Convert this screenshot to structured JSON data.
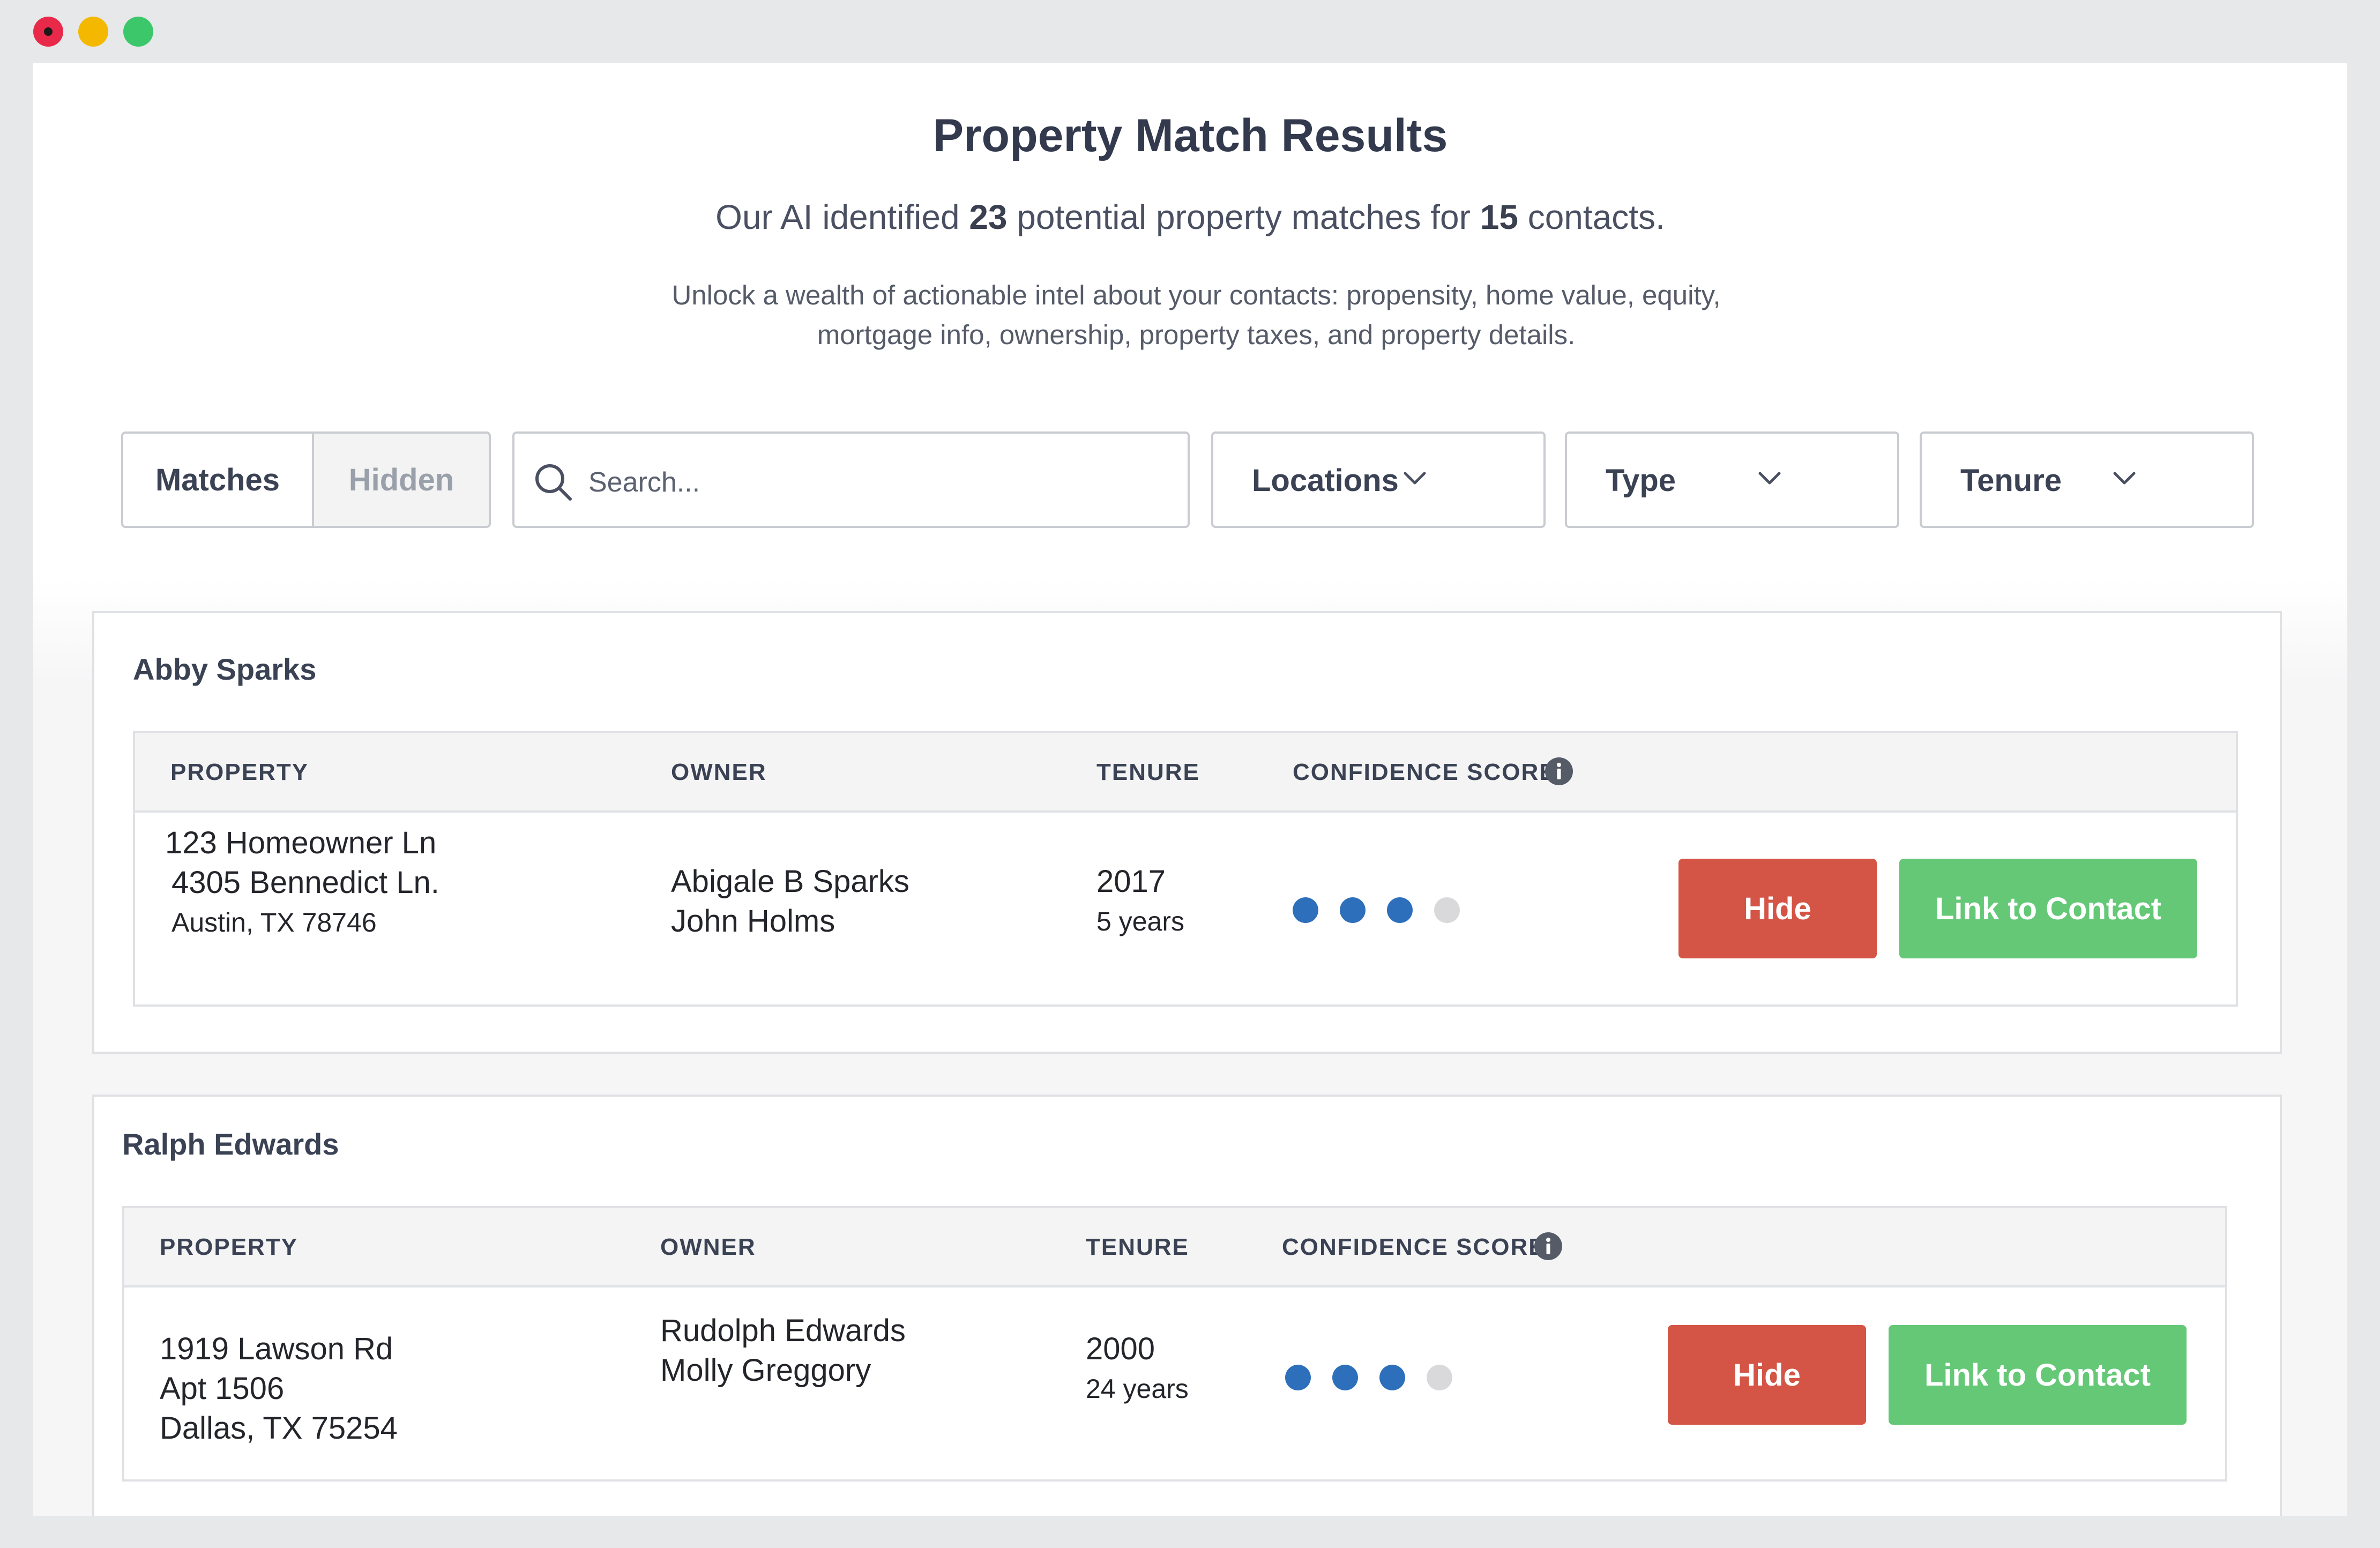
{
  "header": {
    "title": "Property Match Results",
    "subtitle_prefix": "Our AI identified ",
    "match_count": "23",
    "subtitle_middle": " potential property matches for ",
    "contact_count": "15",
    "subtitle_suffix": " contacts.",
    "description_line1": "Unlock a wealth of actionable intel about your contacts: propensity, home value, equity,",
    "description_line2": "mortgage info, ownership, property taxes, and property details."
  },
  "filters": {
    "segments": [
      "Matches",
      "Hidden"
    ],
    "active_segment": "Matches",
    "search_placeholder": "Search...",
    "search_value": "",
    "dropdowns": [
      "Locations",
      "Type",
      "Tenure"
    ]
  },
  "columns": {
    "property": "PROPERTY",
    "owner": "OWNER",
    "tenure": "TENURE",
    "confidence": "CONFIDENCE SCORE"
  },
  "actions": {
    "hide": "Hide",
    "link": "Link to Contact"
  },
  "colors": {
    "hide_button": "#d45545",
    "link_button": "#64c877",
    "score_on": "#2d6fba",
    "score_off": "#d9d9dc"
  },
  "contacts": [
    {
      "name": "Abby Sparks",
      "property": [
        "123 Homeowner Ln",
        "4305 Bennedict Ln.",
        "Austin, TX 78746"
      ],
      "owners": [
        "Abigale B Sparks",
        "John Holms"
      ],
      "tenure_year": "2017",
      "tenure_length": "5 years",
      "confidence": {
        "score": 3,
        "max": 4
      }
    },
    {
      "name": "Ralph Edwards",
      "property": [
        "1919 Lawson Rd",
        "Apt 1506",
        "Dallas, TX 75254"
      ],
      "owners": [
        "Rudolph Edwards",
        "Molly Greggory"
      ],
      "tenure_year": "2000",
      "tenure_length": "24 years",
      "confidence": {
        "score": 3,
        "max": 4
      }
    }
  ]
}
